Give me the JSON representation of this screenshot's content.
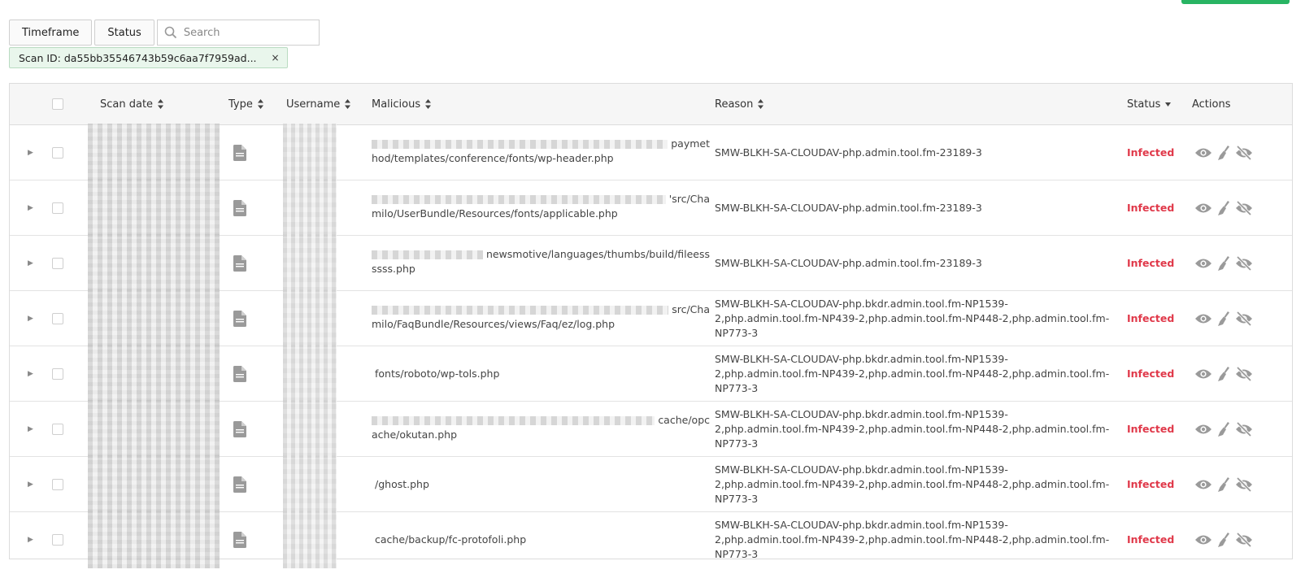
{
  "toolbar": {
    "timeframe_label": "Timeframe",
    "status_label": "Status",
    "search_placeholder": "Search"
  },
  "filter_chip": {
    "label": "Scan ID: da55bb35546743b59c6aa7f7959ad...",
    "remove": "×"
  },
  "columns": {
    "scan_date": "Scan date",
    "type": "Type",
    "username": "Username",
    "malicious": "Malicious",
    "reason": "Reason",
    "status": "Status",
    "actions": "Actions"
  },
  "rows": [
    {
      "mal_line1": "paymet",
      "mal_line2": "hod/templates/conference/fonts/wp-header.php",
      "reason": "SMW-BLKH-SA-CLOUDAV-php.admin.tool.fm-23189-3",
      "status": "Infected"
    },
    {
      "mal_line1": "'src/Cha",
      "mal_line2": "milo/UserBundle/Resources/fonts/applicable.php",
      "reason": "SMW-BLKH-SA-CLOUDAV-php.admin.tool.fm-23189-3",
      "status": "Infected"
    },
    {
      "mal_line1": "newsmotive/languages/thumbs/build/fileess",
      "mal_line2": "ssss.php",
      "reason": "SMW-BLKH-SA-CLOUDAV-php.admin.tool.fm-23189-3",
      "status": "Infected"
    },
    {
      "mal_line1": "src/Cha",
      "mal_line2": "milo/FaqBundle/Resources/views/Faq/ez/log.php",
      "reason": "SMW-BLKH-SA-CLOUDAV-php.bkdr.admin.tool.fm-NP1539-2,php.admin.tool.fm-NP439-2,php.admin.tool.fm-NP448-2,php.admin.tool.fm-NP773-3",
      "status": "Infected"
    },
    {
      "mal_line1": "fonts/roboto/wp-tols.php",
      "mal_line2": "",
      "reason": "SMW-BLKH-SA-CLOUDAV-php.bkdr.admin.tool.fm-NP1539-2,php.admin.tool.fm-NP439-2,php.admin.tool.fm-NP448-2,php.admin.tool.fm-NP773-3",
      "status": "Infected"
    },
    {
      "mal_line1": "cache/opc",
      "mal_line2": "ache/okutan.php",
      "reason": "SMW-BLKH-SA-CLOUDAV-php.bkdr.admin.tool.fm-NP1539-2,php.admin.tool.fm-NP439-2,php.admin.tool.fm-NP448-2,php.admin.tool.fm-NP773-3",
      "status": "Infected"
    },
    {
      "mal_line1": "/ghost.php",
      "mal_line2": "",
      "reason": "SMW-BLKH-SA-CLOUDAV-php.bkdr.admin.tool.fm-NP1539-2,php.admin.tool.fm-NP439-2,php.admin.tool.fm-NP448-2,php.admin.tool.fm-NP773-3",
      "status": "Infected"
    },
    {
      "mal_line1": "cache/backup/fc-protofoli.php",
      "mal_line2": "",
      "reason": "SMW-BLKH-SA-CLOUDAV-php.bkdr.admin.tool.fm-NP1539-2,php.admin.tool.fm-NP439-2,php.admin.tool.fm-NP448-2,php.admin.tool.fm-NP773-3",
      "status": "Infected"
    }
  ],
  "colors": {
    "infected": "#e0394a",
    "chip_bg": "#e9f6ec",
    "accent_green": "#28b463"
  },
  "icons": {
    "type": "file-icon",
    "actions": [
      "eye-icon",
      "broom-icon",
      "eye-off-icon"
    ]
  }
}
